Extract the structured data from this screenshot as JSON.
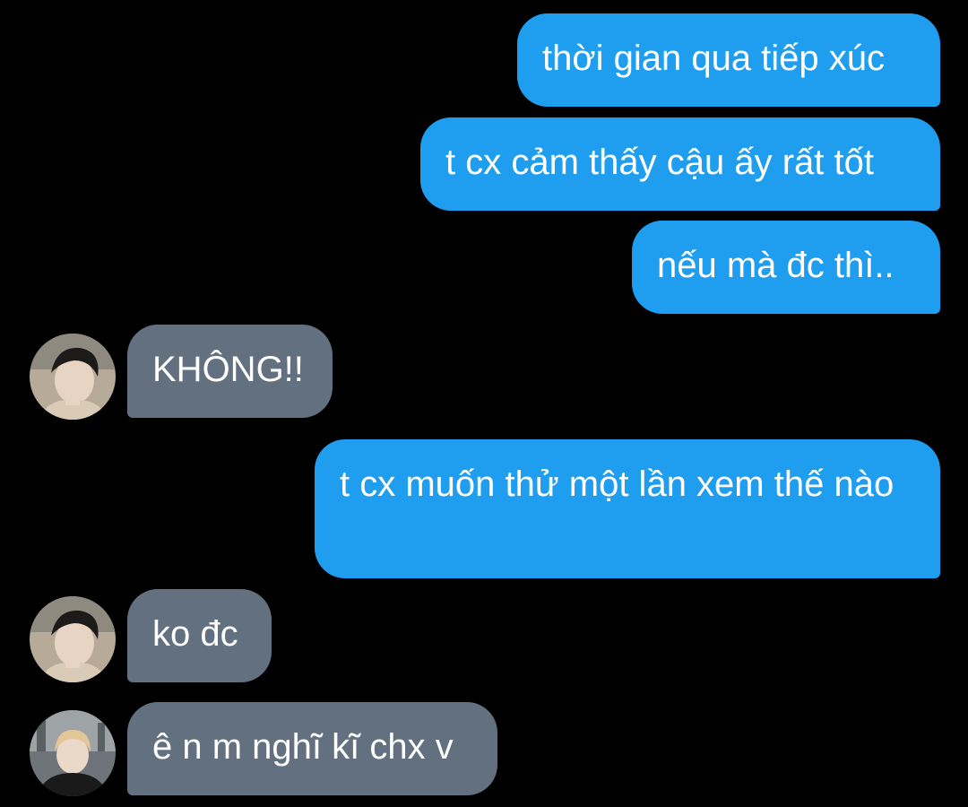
{
  "chat": {
    "messages": [
      {
        "side": "out",
        "text": "thời gian qua tiếp xúc"
      },
      {
        "side": "out",
        "text": "t cx cảm thấy cậu ấy rất tốt"
      },
      {
        "side": "out",
        "text": "nếu mà đc thì.."
      },
      {
        "side": "in",
        "text": "KHÔNG!!",
        "avatar": "avatar-boy-light"
      },
      {
        "side": "out",
        "text": "t cx muốn thử một lần xem thế nào"
      },
      {
        "side": "in",
        "text": "ko đc",
        "avatar": "avatar-boy-light"
      },
      {
        "side": "in",
        "text": "ê n m nghĩ kĩ chx v",
        "avatar": "avatar-boy-dark"
      }
    ]
  },
  "colors": {
    "background": "#000000",
    "outgoing_bubble": "#1f9ef0",
    "incoming_bubble": "#637080",
    "text": "#ffffff"
  }
}
